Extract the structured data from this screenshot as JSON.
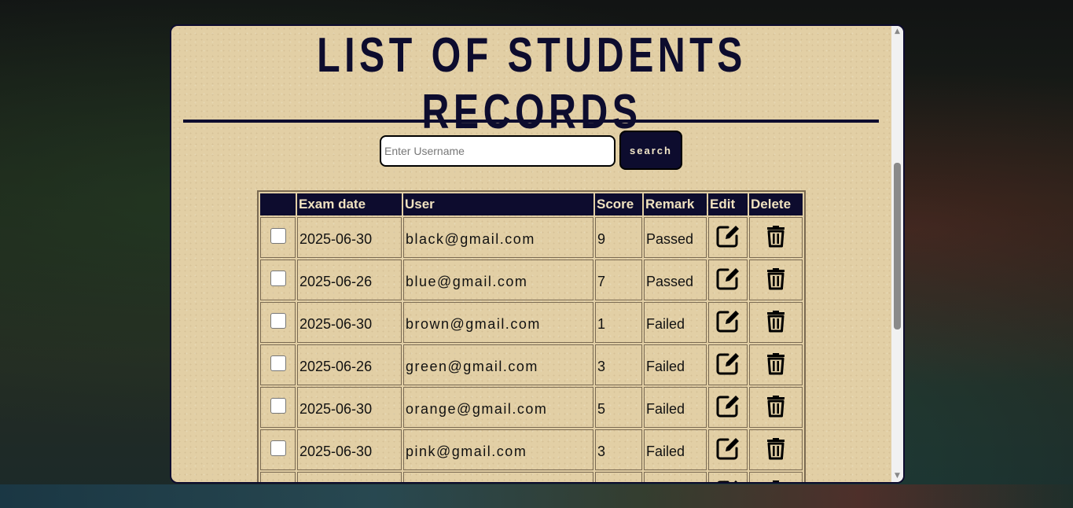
{
  "page": {
    "title": "LIST OF STUDENTS RECORDS"
  },
  "search": {
    "placeholder": "Enter Username",
    "value": "",
    "button_label": "search"
  },
  "table": {
    "headers": [
      "",
      "Exam date",
      "User",
      "Score",
      "Remark",
      "Edit",
      "Delete"
    ],
    "rows": [
      {
        "date": "2025-06-30",
        "user": "black@gmail.com",
        "score": "9",
        "remark": "Passed"
      },
      {
        "date": "2025-06-26",
        "user": "blue@gmail.com",
        "score": "7",
        "remark": "Passed"
      },
      {
        "date": "2025-06-30",
        "user": "brown@gmail.com",
        "score": "1",
        "remark": "Failed"
      },
      {
        "date": "2025-06-26",
        "user": "green@gmail.com",
        "score": "3",
        "remark": "Failed"
      },
      {
        "date": "2025-06-30",
        "user": "orange@gmail.com",
        "score": "5",
        "remark": "Failed"
      },
      {
        "date": "2025-06-30",
        "user": "pink@gmail.com",
        "score": "3",
        "remark": "Failed"
      },
      {
        "date": "",
        "user": "",
        "score": "",
        "remark": ""
      }
    ],
    "edit_icon": "edit-icon",
    "delete_icon": "trash-icon"
  },
  "colors": {
    "navy": "#0d0c2e",
    "paper": "#e2cfa5",
    "header_text": "#f0e2c0"
  }
}
